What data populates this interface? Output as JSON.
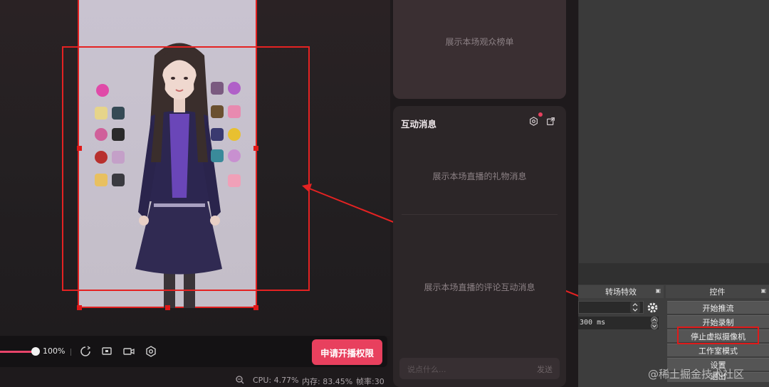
{
  "preview": {
    "zoom": "100%"
  },
  "controls": {
    "apply_button": "申请开播权限"
  },
  "status": {
    "cpu": "CPU: 4.77%",
    "memory": "内存: 83.45%",
    "fps": "帧率:30"
  },
  "audience_panel": {
    "hint": "展示本场观众榜单"
  },
  "messages_panel": {
    "title": "互动消息",
    "gift_hint": "展示本场直播的礼物消息",
    "comment_hint": "展示本场直播的评论互动消息",
    "input_placeholder": "说点什么...",
    "send_label": "发送"
  },
  "obs": {
    "transitions_title": "转场特效",
    "controls_title": "控件",
    "duration": "300 ms",
    "buttons": [
      "开始推流",
      "开始录制",
      "停止虚拟摄像机",
      "工作室模式",
      "设置",
      "退出"
    ]
  },
  "watermark": "@稀土掘金技术社区",
  "colors": {
    "accent": "#e8405e",
    "annotation": "#e42222"
  }
}
